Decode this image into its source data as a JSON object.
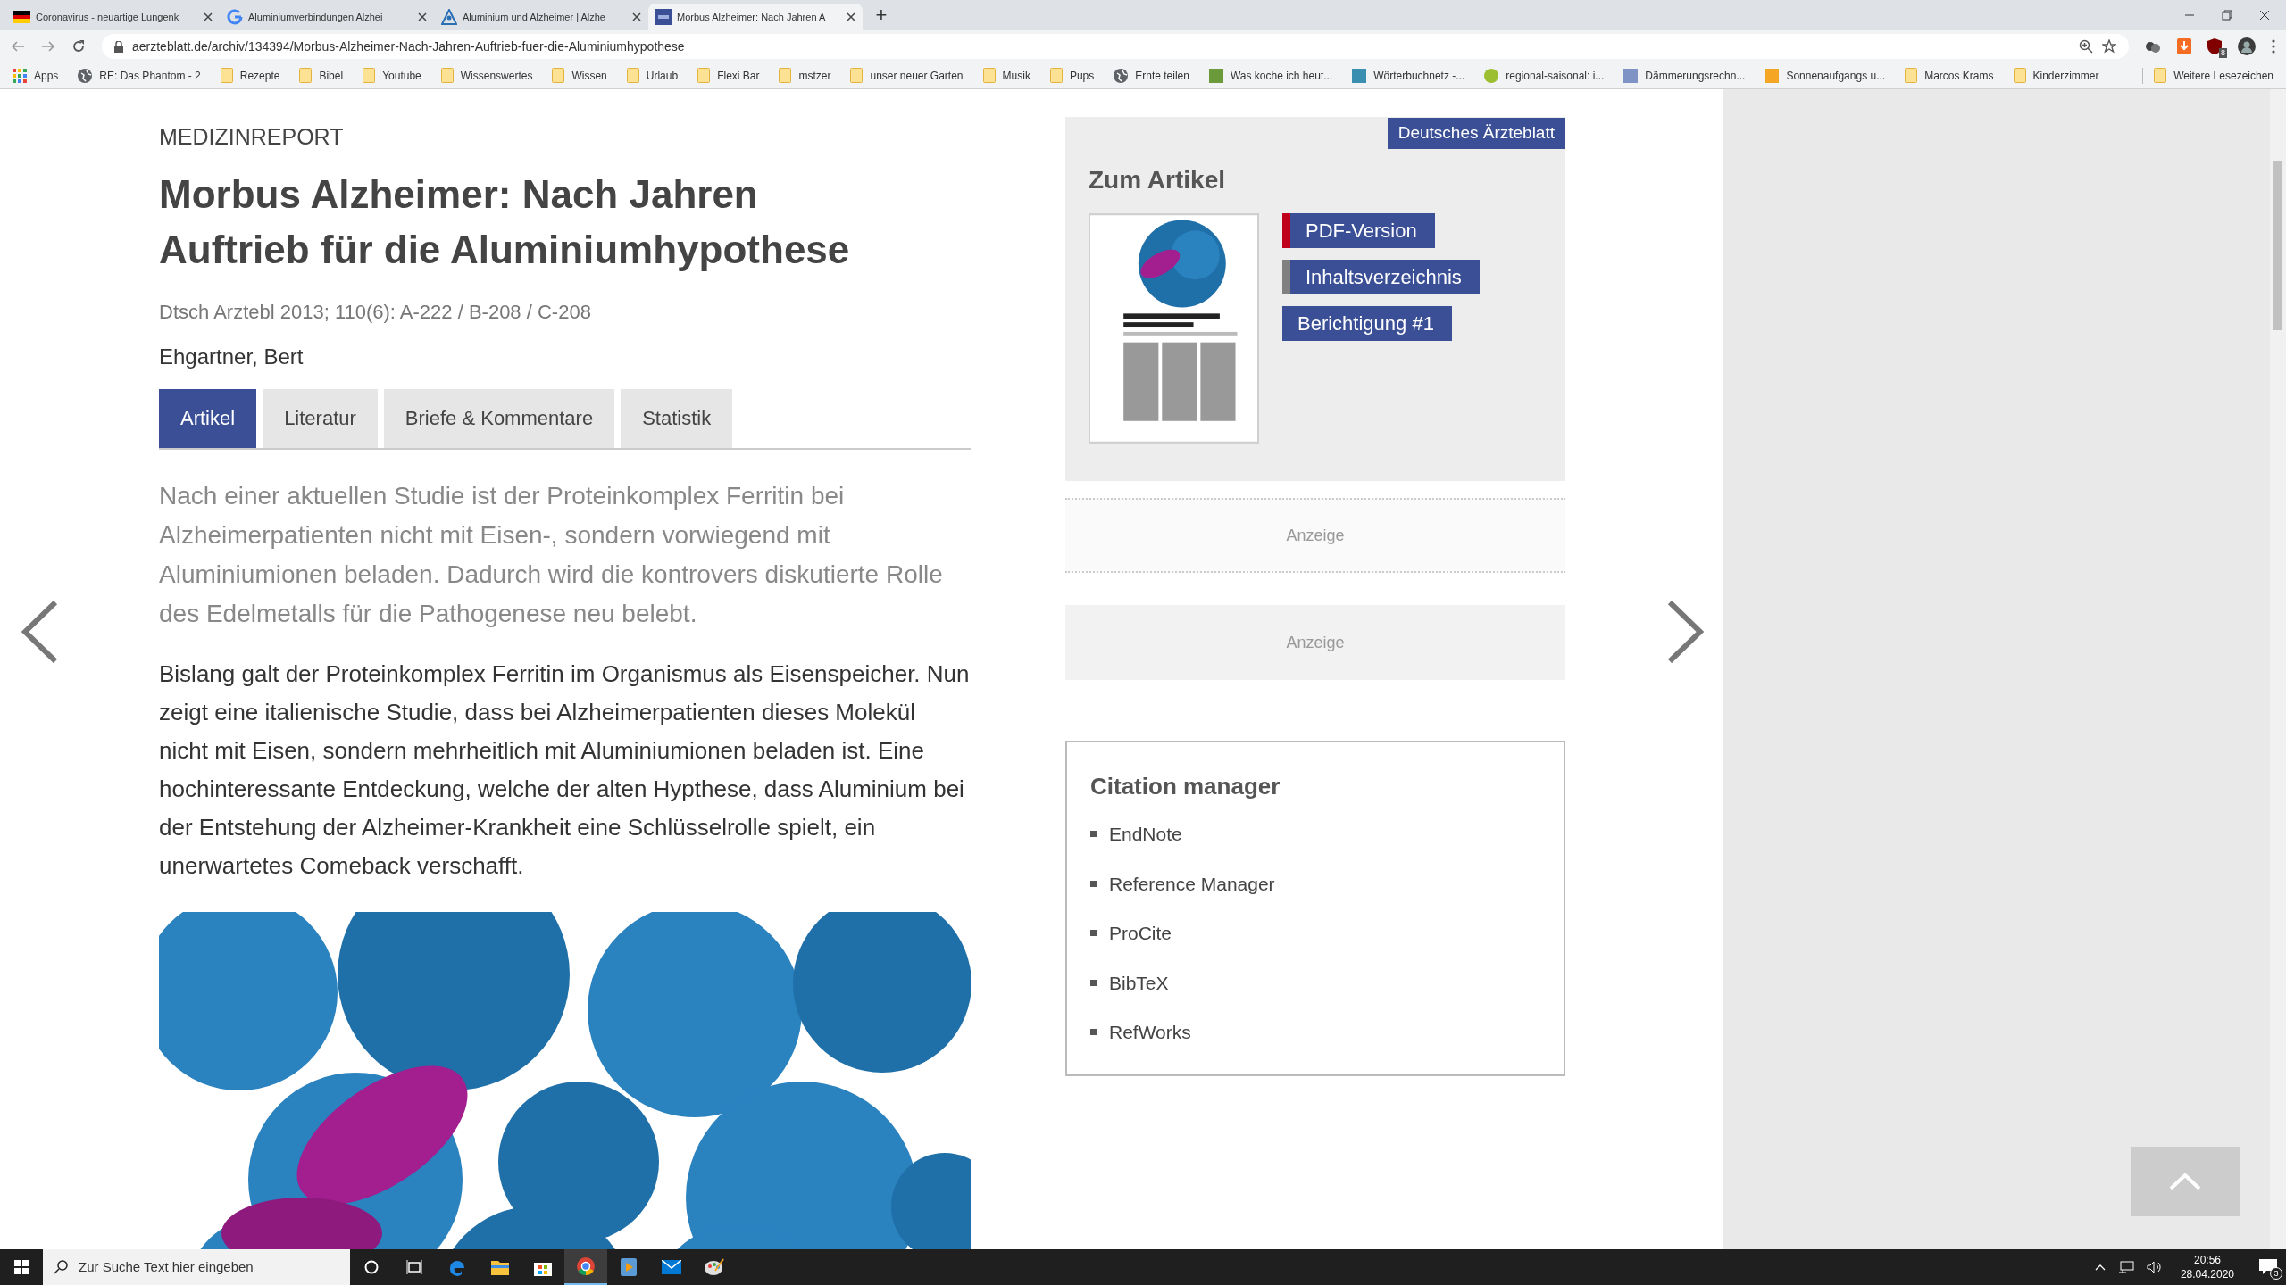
{
  "browser": {
    "tabs": [
      {
        "title": "Coronavirus - neuartige Lungenk",
        "kind": "flag",
        "selected": false
      },
      {
        "title": "Aluminiumverbindungen Alzhei",
        "kind": "google",
        "selected": false
      },
      {
        "title": "Aluminium und Alzheimer | Alzhe",
        "kind": "triangle",
        "selected": false
      },
      {
        "title": "Morbus Alzheimer: Nach Jahren A",
        "kind": "site",
        "selected": true
      }
    ],
    "new_tab": "+",
    "url": "aerzteblatt.de/archiv/134394/Morbus-Alzheimer-Nach-Jahren-Auftrieb-fuer-die-Aluminiumhypothese",
    "extension_badge": "8",
    "bookmarks": [
      {
        "label": "Apps",
        "kind": "apps"
      },
      {
        "label": "RE: Das Phantom - 2",
        "kind": "globe"
      },
      {
        "label": "Rezepte",
        "kind": "folder"
      },
      {
        "label": "Bibel",
        "kind": "folder"
      },
      {
        "label": "Youtube",
        "kind": "folder"
      },
      {
        "label": "Wissenswertes",
        "kind": "folder"
      },
      {
        "label": "Wissen",
        "kind": "folder"
      },
      {
        "label": "Urlaub",
        "kind": "folder"
      },
      {
        "label": "Flexi Bar",
        "kind": "folder"
      },
      {
        "label": "mstzer",
        "kind": "folder"
      },
      {
        "label": "unser neuer Garten",
        "kind": "folder"
      },
      {
        "label": "Musik",
        "kind": "folder"
      },
      {
        "label": "Pups",
        "kind": "folder"
      },
      {
        "label": "Ernte teilen",
        "kind": "globe"
      },
      {
        "label": "Was koche ich heut...",
        "kind": "site",
        "color": "#6a9a3a"
      },
      {
        "label": "Wörterbuchnetz -...",
        "kind": "site",
        "color": "#3a8fb0"
      },
      {
        "label": "regional-saisonal: i...",
        "kind": "round",
        "color": "#9bbf30"
      },
      {
        "label": "Dämmerungsrechn...",
        "kind": "site",
        "color": "#7f93c4"
      },
      {
        "label": "Sonnenaufgangs u...",
        "kind": "site",
        "color": "#f5a623"
      },
      {
        "label": "Marcos Krams",
        "kind": "folder"
      },
      {
        "label": "Kinderzimmer",
        "kind": "folder"
      }
    ],
    "more_bookmarks": "Weitere Lesezeichen"
  },
  "article": {
    "section": "MEDIZINREPORT",
    "title": "Morbus Alzheimer: Nach Jahren Auftrieb für die Aluminiumhypothese",
    "citation": "Dtsch Arztebl 2013; 110(6): A-222 / B-208 / C-208",
    "author": "Ehgartner, Bert",
    "tabs": [
      {
        "label": "Artikel",
        "selected": true
      },
      {
        "label": "Literatur",
        "selected": false
      },
      {
        "label": "Briefe & Kommentare",
        "selected": false
      },
      {
        "label": "Statistik",
        "selected": false
      }
    ],
    "lead": "Nach einer aktuellen Studie ist der Proteinkomplex Ferritin bei Alzheimerpatienten nicht mit Eisen-, sondern vorwiegend mit Aluminiumionen beladen. Dadurch wird die kontrovers diskutierte Rolle des Edelmetalls für die Pathogenese neu belebt.",
    "body": "Bislang galt der Proteinkomplex Ferritin im Organismus als Eisenspeicher. Nun zeigt eine italienische Studie, dass bei Alzheimerpatienten dieses Molekül nicht mit Eisen, sondern mehrheitlich mit Aluminiumionen beladen ist. Eine hochinteressante Entdeckung, welche der alten Hypthese, dass Aluminium bei der Entstehung der Alzheimer-Krankheit eine Schlüsselrolle spielt, ein unerwartetes Comeback verschafft."
  },
  "sidebar": {
    "badge": "Deutsches Ärzteblatt",
    "heading": "Zum Artikel",
    "links": [
      {
        "label": "PDF-Version",
        "color": "#c0001a"
      },
      {
        "label": "Inhaltsverzeichnis",
        "color": "#808080"
      },
      {
        "label": "Berichtigung #1"
      }
    ],
    "ads": [
      {
        "label": "Anzeige",
        "kind": "dotted"
      },
      {
        "label": "Anzeige",
        "kind": "filled"
      }
    ],
    "citation_manager": {
      "heading": "Citation manager",
      "items": [
        "EndNote",
        "Reference Manager",
        "ProCite",
        "BibTeX",
        "RefWorks"
      ]
    }
  },
  "taskbar": {
    "search": {
      "placeholder": "Zur Suche Text hier eingeben"
    },
    "time": "20:56",
    "date": "28.04.2020",
    "notifications": "3"
  }
}
